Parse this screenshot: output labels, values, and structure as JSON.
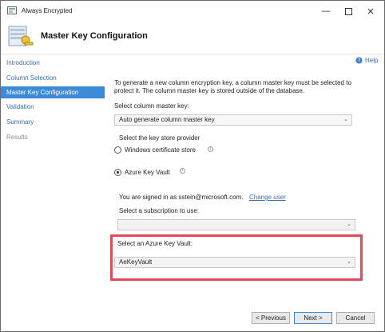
{
  "window": {
    "title": "Always Encrypted"
  },
  "header": {
    "title": "Master Key Configuration"
  },
  "help_label": "Help",
  "sidebar": {
    "items": [
      {
        "label": "Introduction",
        "state": "link"
      },
      {
        "label": "Column Selection",
        "state": "link"
      },
      {
        "label": "Master Key Configuration",
        "state": "active"
      },
      {
        "label": "Validation",
        "state": "link"
      },
      {
        "label": "Summary",
        "state": "link"
      },
      {
        "label": "Results",
        "state": "disabled"
      }
    ]
  },
  "main": {
    "description": "To generate a new column encryption key, a column master key must be selected to protect it.  The column master key is stored outside of the database.",
    "select_cmk_label": "Select column master key:",
    "select_cmk_value": "Auto generate column master key",
    "key_store_label": "Select the key store provider",
    "option_windows": "Windows certificate store",
    "option_azure": "Azure Key Vault",
    "selected_option": "azure",
    "signed_in_text": "You are signed in as sstein@microsoft.com.",
    "change_user": "Change user",
    "subscription_label": "Select a subscription to use:",
    "subscription_value": "",
    "vault_label": "Select an Azure Key Vault:",
    "vault_value": "AeKeyVault"
  },
  "footer": {
    "previous": "< Previous",
    "next": "Next >",
    "cancel": "Cancel"
  },
  "colors": {
    "accent": "#3d8bd8",
    "highlight": "#e04a5b",
    "link": "#3a6ea5"
  }
}
